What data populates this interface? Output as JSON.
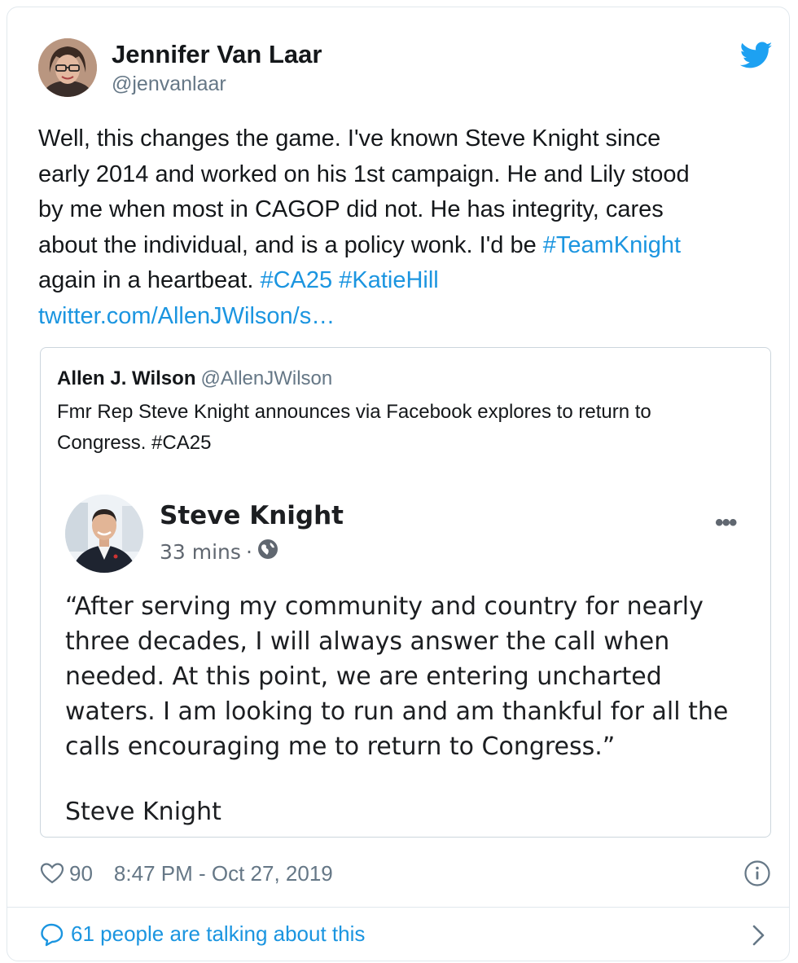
{
  "tweet": {
    "author_name": "Jennifer Van Laar",
    "author_handle": "@jenvanlaar",
    "text_lines": [
      [
        {
          "t": "Well, this changes the game. I've known Steve Knight since"
        }
      ],
      [
        {
          "t": "early 2014 and worked on his 1st campaign. He and Lily stood"
        }
      ],
      [
        {
          "t": "by me when most in CAGOP did not. He has integrity, cares"
        }
      ],
      [
        {
          "t": "about the individual, and is a policy wonk. I'd be "
        },
        {
          "t": "#TeamKnight",
          "link": true
        }
      ],
      [
        {
          "t": "again in a heartbeat. "
        },
        {
          "t": "#CA25",
          "link": true
        },
        {
          "t": " "
        },
        {
          "t": "#KatieHill",
          "link": true
        }
      ],
      [
        {
          "t": "twitter.com/AllenJWilson/s…",
          "link": true
        }
      ]
    ],
    "likes": "90",
    "timestamp": "8:47 PM - Oct 27, 2019",
    "talking": "61 people are talking about this",
    "accent_color": "#1b95e0"
  },
  "quote": {
    "name": "Allen J. Wilson",
    "handle": "@AllenJWilson",
    "text_lines": [
      "Fmr Rep Steve Knight announces via Facebook explores to return to",
      "Congress. #CA25"
    ]
  },
  "fb_post": {
    "name": "Steve Knight",
    "time": "33 mins",
    "separator": "·",
    "more": "•••",
    "text_lines": [
      "“After serving my community and country for nearly",
      "three decades, I will always answer the call when",
      "needed.  At this point, we are entering uncharted",
      "waters. I am looking to run and am thankful for all the",
      "calls encouraging me to return to Congress.”"
    ],
    "signature": "Steve Knight"
  },
  "icons": {
    "brand": "twitter-bird-icon",
    "like": "heart-icon",
    "info": "info-icon",
    "reply": "speech-bubble-icon",
    "audience": "globe-icon",
    "more": "chevron-right-icon"
  }
}
